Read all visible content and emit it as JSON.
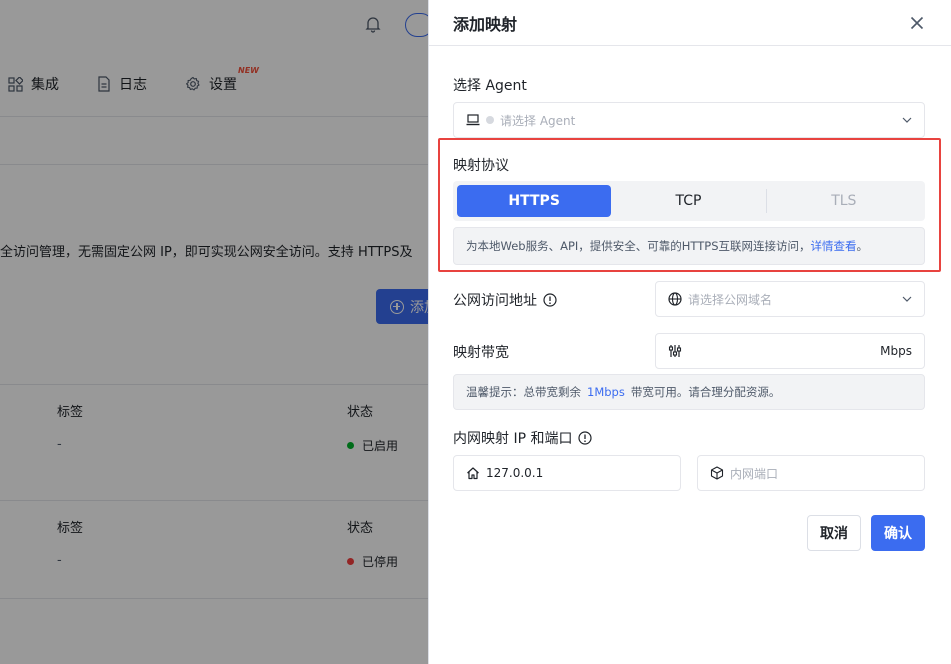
{
  "background": {
    "nav": [
      {
        "icon": "grid-icon",
        "label": "集成"
      },
      {
        "icon": "doc-icon",
        "label": "日志"
      },
      {
        "icon": "gear-icon",
        "label": "设置",
        "badge": "NEW"
      }
    ],
    "description": "全访问管理，无需固定公网 IP，即可实现公网安全访问。支持 HTTPS及",
    "add_button_label": "添加",
    "table_rows": [
      {
        "label_header": "标签",
        "label_value": "-",
        "status_header": "状态",
        "status": "已启用",
        "status_color": "#00b42a"
      },
      {
        "label_header": "标签",
        "label_value": "-",
        "status_header": "状态",
        "status": "已停用",
        "status_color": "#f53f3f"
      }
    ]
  },
  "drawer": {
    "title": "添加映射",
    "agent": {
      "label": "选择 Agent",
      "placeholder": "请选择 Agent"
    },
    "protocol": {
      "label": "映射协议",
      "options": [
        {
          "label": "HTTPS",
          "state": "active"
        },
        {
          "label": "TCP",
          "state": "normal"
        },
        {
          "label": "TLS",
          "state": "disabled"
        }
      ],
      "hint_text": "为本地Web服务、API，提供安全、可靠的HTTPS互联网连接访问，",
      "hint_link": "详情查看",
      "hint_end": "。"
    },
    "public_address": {
      "label": "公网访问地址",
      "placeholder": "请选择公网域名"
    },
    "bandwidth": {
      "label": "映射带宽",
      "unit": "Mbps",
      "value": ""
    },
    "tip": {
      "prefix": "温馨提示：总带宽剩余",
      "highlight": "1Mbps",
      "suffix": "带宽可用。请合理分配资源。"
    },
    "internal": {
      "label": "内网映射 IP 和端口",
      "ip_value": "127.0.0.1",
      "port_placeholder": "内网端口"
    },
    "buttons": {
      "cancel": "取消",
      "confirm": "确认"
    }
  },
  "colors": {
    "primary": "#3b6cf0",
    "highlight_border": "#e8433f",
    "enabled": "#00b42a",
    "disabled": "#f53f3f"
  }
}
